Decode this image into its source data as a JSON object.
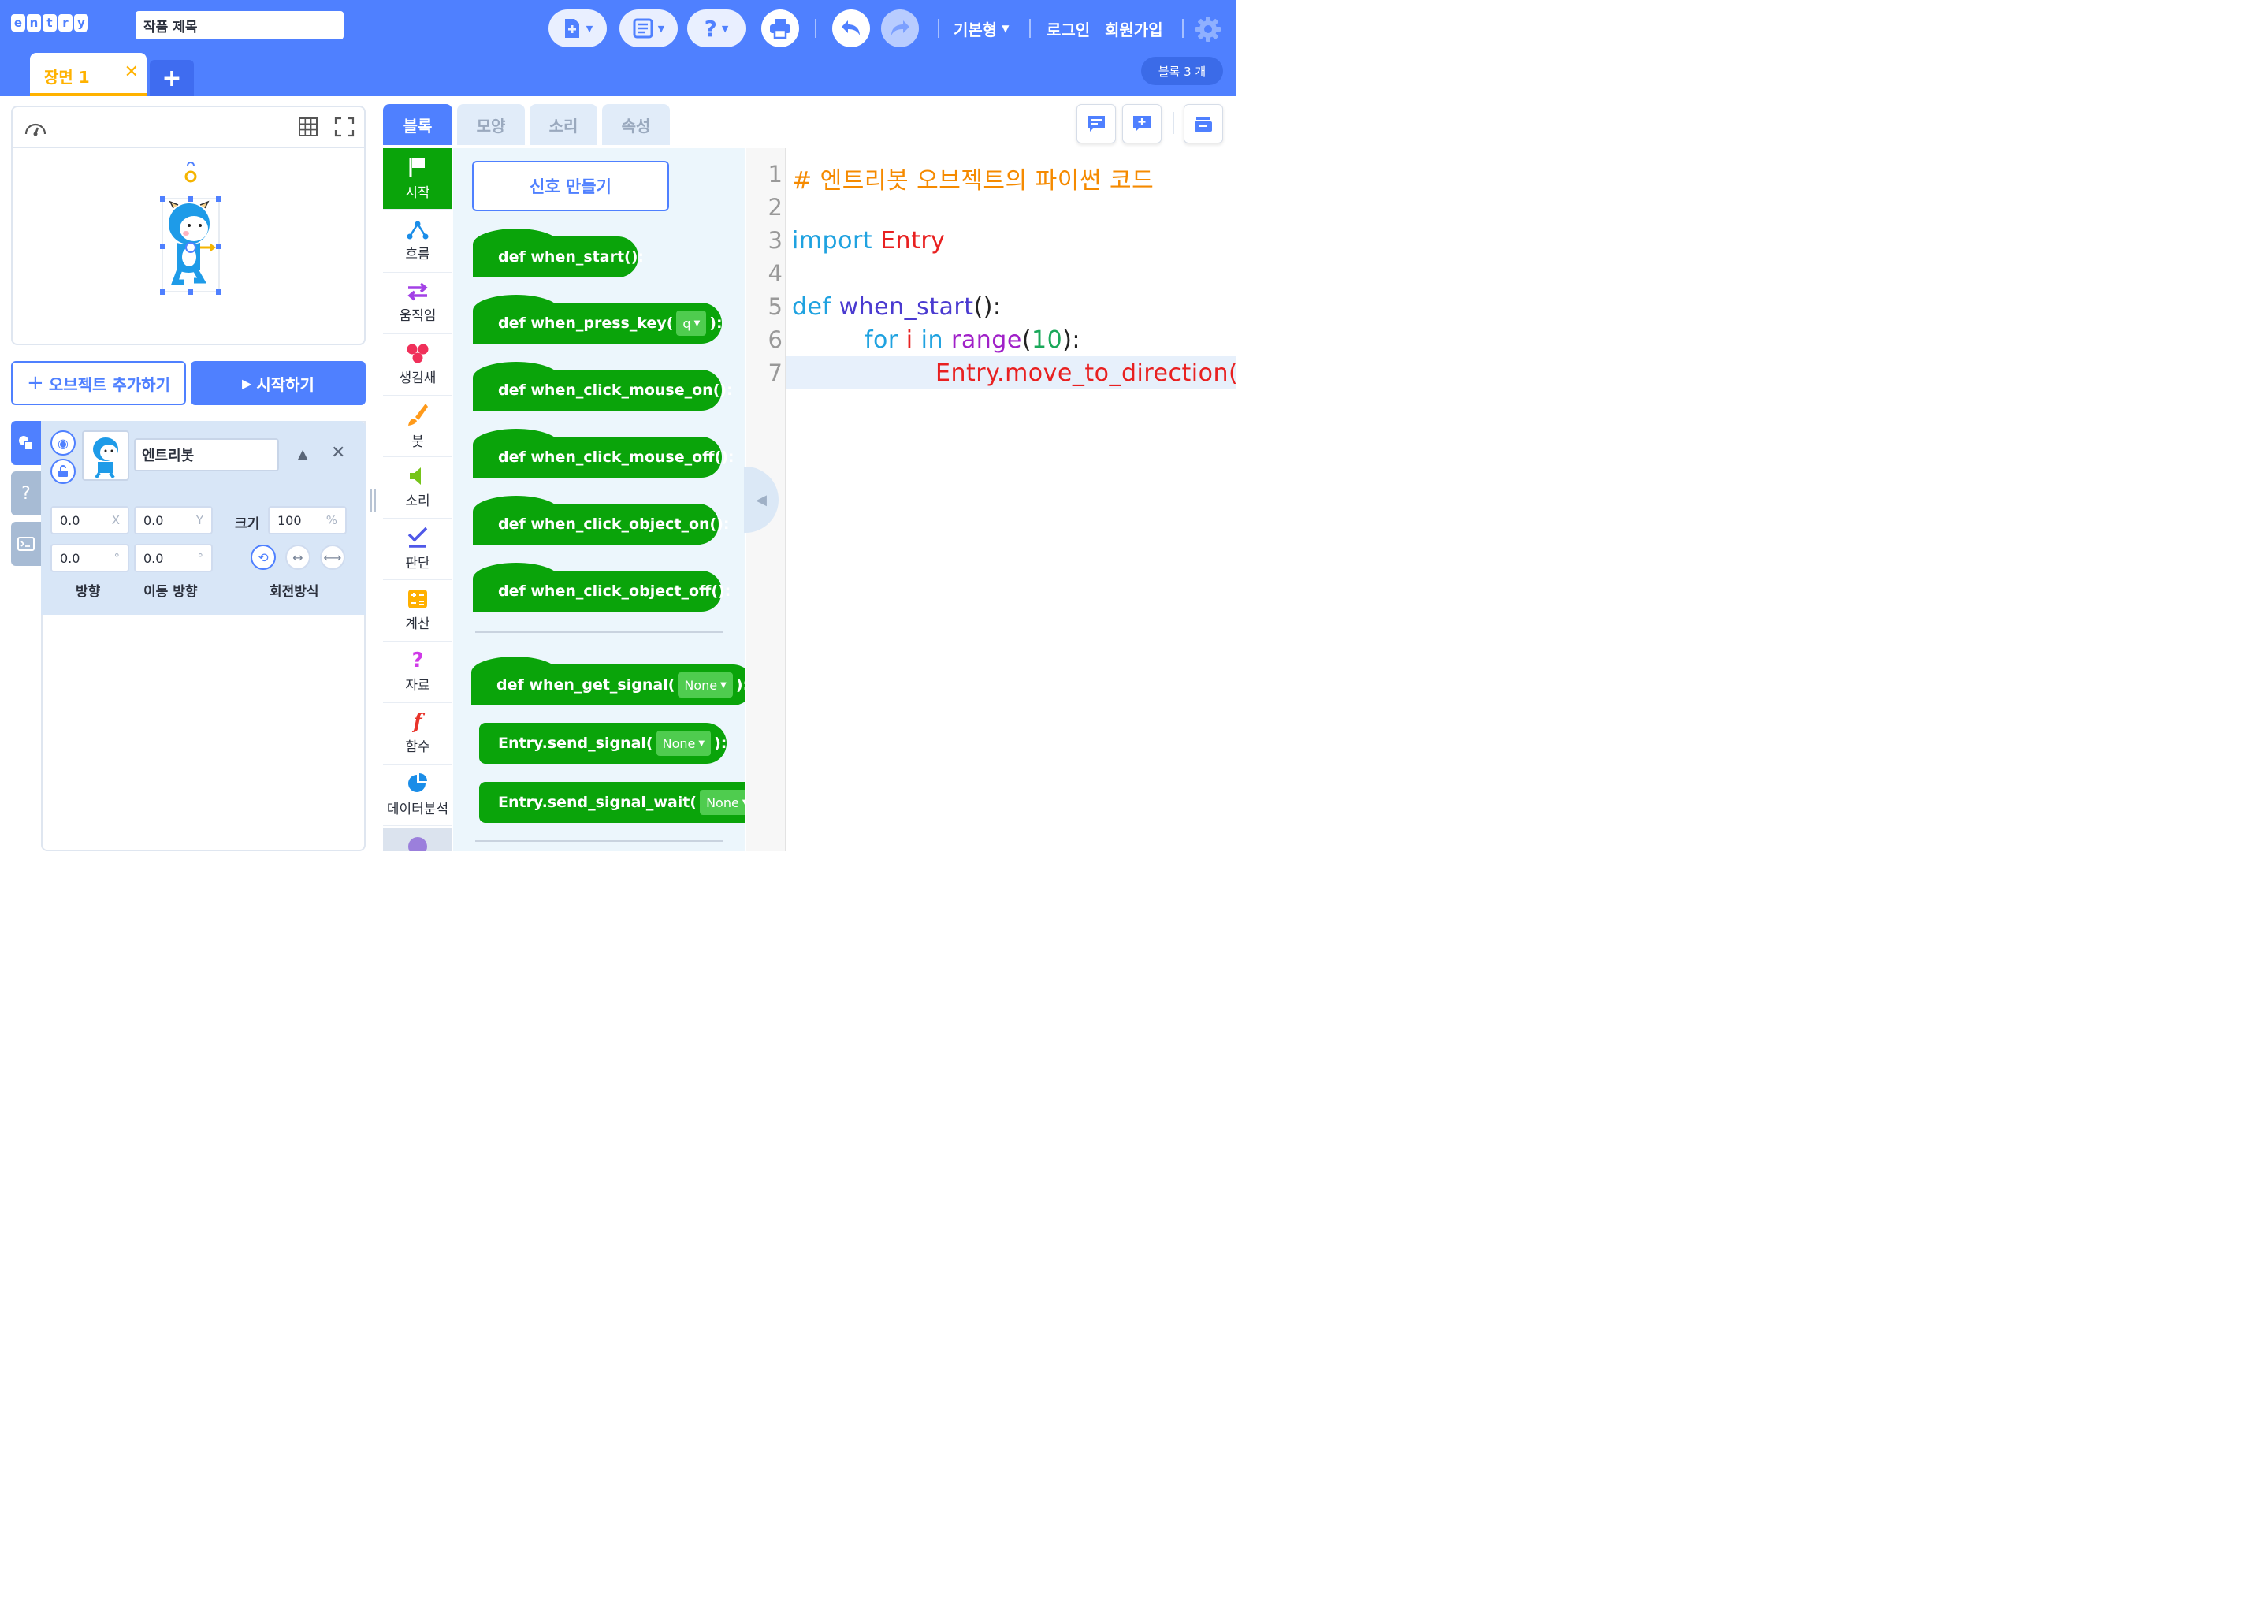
{
  "app": {
    "logo_letters": [
      "e",
      "n",
      "t",
      "r",
      "y"
    ]
  },
  "header": {
    "project_title": "작품 제목",
    "mode_label": "기본형",
    "login": "로그인",
    "signup": "회원가입",
    "block_count": "블록 3 개"
  },
  "scenes": [
    {
      "label": "장면 1"
    }
  ],
  "buttons": {
    "add_object": "오브젝트 추가하기",
    "start": "시작하기"
  },
  "object": {
    "name": "엔트리봇",
    "x": "0.0",
    "x_suffix": "X",
    "y": "0.0",
    "y_suffix": "Y",
    "size_label": "크기",
    "size": "100",
    "size_suffix": "%",
    "direction": "0.0",
    "move_direction": "0.0",
    "degree": "°",
    "direction_label": "방향",
    "move_direction_label": "이동 방향",
    "rotation_label": "회전방식"
  },
  "workspace_tabs": [
    "블록",
    "모양",
    "소리",
    "속성"
  ],
  "categories": [
    "시작",
    "흐름",
    "움직임",
    "생김새",
    "붓",
    "소리",
    "판단",
    "계산",
    "자료",
    "함수",
    "데이터분석"
  ],
  "palette": {
    "signal_button": "신호 만들기",
    "blocks": [
      {
        "text": "def when_start():"
      },
      {
        "text": "def when_press_key(",
        "dropdown": "q",
        "tail": "):"
      },
      {
        "text": "def when_click_mouse_on():"
      },
      {
        "text": "def when_click_mouse_off():"
      },
      {
        "text": "def when_click_object_on():"
      },
      {
        "text": "def when_click_object_off():"
      },
      {
        "text": "def when_get_signal(",
        "dropdown": "None",
        "tail": "):"
      },
      {
        "text": "Entry.send_signal(",
        "dropdown": "None",
        "tail": "):"
      },
      {
        "text": "Entry.send_signal_wait(",
        "dropdown": "None",
        "tail": "):"
      }
    ]
  },
  "code": {
    "line_numbers": [
      "1",
      "2",
      "3",
      "4",
      "5",
      "6",
      "7"
    ],
    "line1": "# 엔트리봇 오브젝트의 파이썬 코드",
    "line3_kw": "import",
    "line3_mod": " Entry",
    "line5_kw": "def",
    "line5_fn": " when_start",
    "line5_p": "():",
    "line6_kw": "for",
    "line6_var": " i",
    "line6_in": " in",
    "line6_fn": " range",
    "line6_p1": "(",
    "line6_num": "10",
    "line6_p2": "):",
    "line7": "Entry.move_to_direction("
  },
  "colors": {
    "accent": "#4f80ff",
    "block_green": "#0aa40a",
    "scene_yellow": "#ffb200"
  }
}
